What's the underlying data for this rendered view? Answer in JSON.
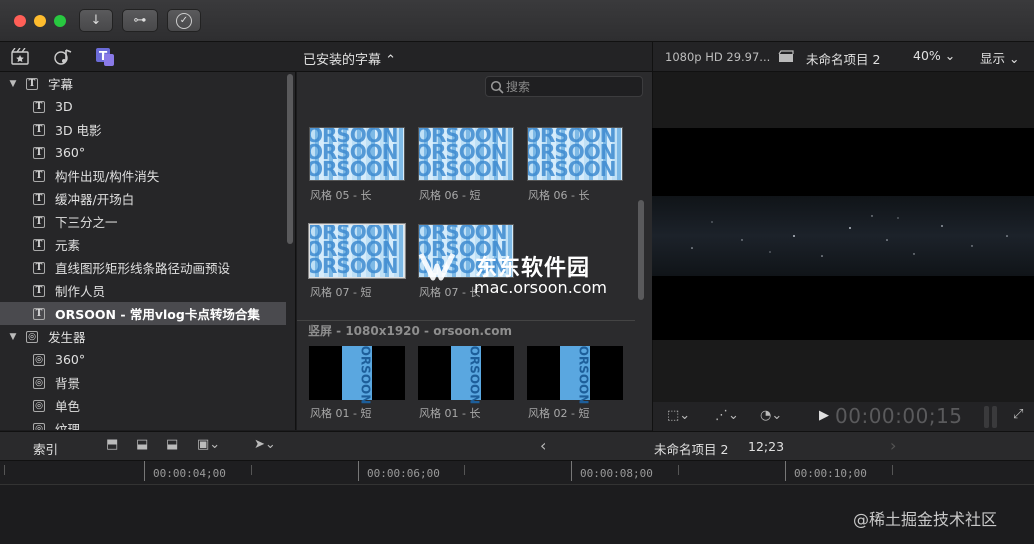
{
  "titlebar": {
    "btn_import": "↓",
    "btn_keywords": "⊶",
    "btn_check": "✓"
  },
  "browser": {
    "library_icon": "film-star-icon",
    "photos_icon": "photos-music-icon",
    "titles_icon": "titles-generators-icon",
    "dropdown_label": "已安装的字幕 ⌃"
  },
  "viewer_header": {
    "format": "1080p HD 29.97...",
    "project": "未命名项目 2",
    "zoom": "40% ⌄",
    "display": "显示 ⌄"
  },
  "sidebar": {
    "items": [
      {
        "label": "字幕",
        "type": "group",
        "icon": "T"
      },
      {
        "label": "3D",
        "type": "item",
        "icon": "T"
      },
      {
        "label": "3D 电影",
        "type": "item",
        "icon": "T"
      },
      {
        "label": "360°",
        "type": "item",
        "icon": "T"
      },
      {
        "label": "构件出现/构件消失",
        "type": "item",
        "icon": "T"
      },
      {
        "label": "缓冲器/开场白",
        "type": "item",
        "icon": "T"
      },
      {
        "label": "下三分之一",
        "type": "item",
        "icon": "T"
      },
      {
        "label": "元素",
        "type": "item",
        "icon": "T"
      },
      {
        "label": "直线图形矩形线条路径动画预设",
        "type": "item",
        "icon": "T"
      },
      {
        "label": "制作人员",
        "type": "item",
        "icon": "T"
      },
      {
        "label": "ORSOON - 常用vlog卡点转场合集",
        "type": "item",
        "icon": "T",
        "selected": true
      },
      {
        "label": "发生器",
        "type": "group",
        "icon": "◎"
      },
      {
        "label": "360°",
        "type": "item",
        "icon": "◎"
      },
      {
        "label": "背景",
        "type": "item",
        "icon": "◎"
      },
      {
        "label": "单色",
        "type": "item",
        "icon": "◎"
      },
      {
        "label": "纹理",
        "type": "item",
        "icon": "◎"
      }
    ]
  },
  "grid": {
    "search_placeholder": "搜索",
    "thumb_text": "ORSOON",
    "captions": [
      "风格 05 - 长",
      "风格 06 - 短",
      "风格 06 - 长",
      "风格 07 - 短",
      "风格 07 - 长"
    ],
    "section_title": "竖屏 - 1080x1920 - orsoon.com",
    "v_captions": [
      "风格 01 - 短",
      "风格 01 - 长",
      "风格 02 - 短"
    ],
    "watermark_title": "东东软件园",
    "watermark_url": "mac.orsoon.com"
  },
  "viewer_controls": {
    "timecode": "00:00:00;15",
    "play": "▶"
  },
  "timeline_bar": {
    "index_label": "索引",
    "project": "未命名项目 2",
    "duration": "12;23",
    "back": "‹",
    "forward": "›"
  },
  "ruler": {
    "labels": [
      "00:00:04;00",
      "00:00:06;00",
      "00:00:08;00",
      "00:00:10;00"
    ]
  },
  "footer_watermark": "@稀土掘金技术社区",
  "colors": {
    "selected_row": "#4a4a4e",
    "accent_blue": "#5aa7e0",
    "titles_icon": "#6b6bd8"
  }
}
